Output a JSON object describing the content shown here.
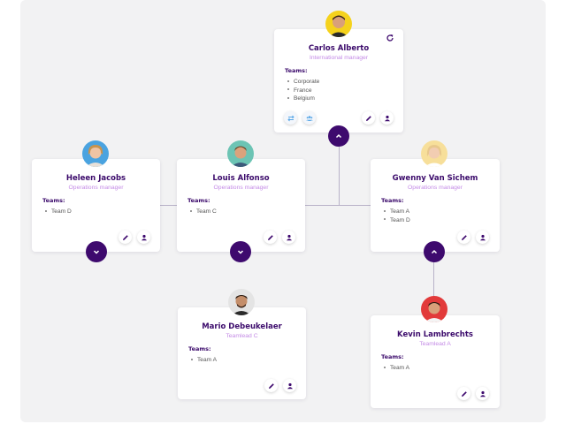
{
  "colors": {
    "accent": "#3e0a6e",
    "role": "#c48be6",
    "connector": "#b9b2c8",
    "canvas": "#f2f2f3"
  },
  "cards": [
    {
      "id": "carlos",
      "name": "Carlos Alberto",
      "role": "International manager",
      "teams_label": "Teams:",
      "teams": [
        "Corporate",
        "France",
        "Belgium"
      ],
      "toggle_icon": "chevron-up-icon",
      "extra_icons": [
        "swap-icon",
        "group-icon",
        "refresh-icon"
      ]
    },
    {
      "id": "heleen",
      "name": "Heleen Jacobs",
      "role": "Operations manager",
      "teams_label": "Teams:",
      "teams": [
        "Team D"
      ],
      "toggle_icon": "chevron-down-icon"
    },
    {
      "id": "louis",
      "name": "Louis Alfonso",
      "role": "Operations manager",
      "teams_label": "Teams:",
      "teams": [
        "Team C"
      ],
      "toggle_icon": "chevron-down-icon"
    },
    {
      "id": "gwenny",
      "name": "Gwenny Van Sichem",
      "role": "Operations manager",
      "teams_label": "Teams:",
      "teams": [
        "Team A",
        "Team D"
      ],
      "toggle_icon": "chevron-up-icon"
    },
    {
      "id": "mario",
      "name": "Mario Debeukelaer",
      "role": "Teamlead C",
      "teams_label": "Teams:",
      "teams": [
        "Team A"
      ]
    },
    {
      "id": "kevin",
      "name": "Kevin Lambrechts",
      "role": "Teamlead A",
      "teams_label": "Teams:",
      "teams": [
        "Team A"
      ]
    }
  ]
}
